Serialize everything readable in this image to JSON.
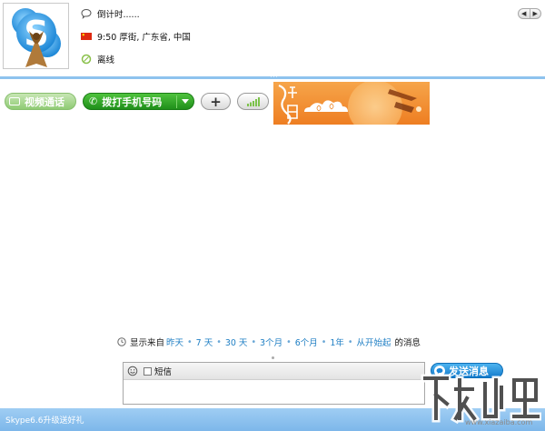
{
  "contact": {
    "mood": "倒计时......",
    "location": "9:50 厚街, 广东省, 中国",
    "status": "离线"
  },
  "toolbar": {
    "video_label": "视频通话",
    "call_label": "拨打手机号码",
    "add_label": "+"
  },
  "history": {
    "prefix": "显示来自",
    "links": [
      "昨天",
      "7 天",
      "30 天",
      "3个月",
      "6个月",
      "1年",
      "从开始起"
    ],
    "separator": "•",
    "suffix": "的消息"
  },
  "compose": {
    "sms_label": "短信",
    "message_value": ""
  },
  "send_label": "发送消息",
  "footer_text": "Skype6.6升级送好礼",
  "watermark": {
    "url": "www.xiazaiba.com"
  },
  "colors": {
    "accent_blue": "#1f7fc4",
    "call_green": "#1f8f1a",
    "footer_blue": "#8fc2ef",
    "banner_orange": "#f39a3a"
  }
}
